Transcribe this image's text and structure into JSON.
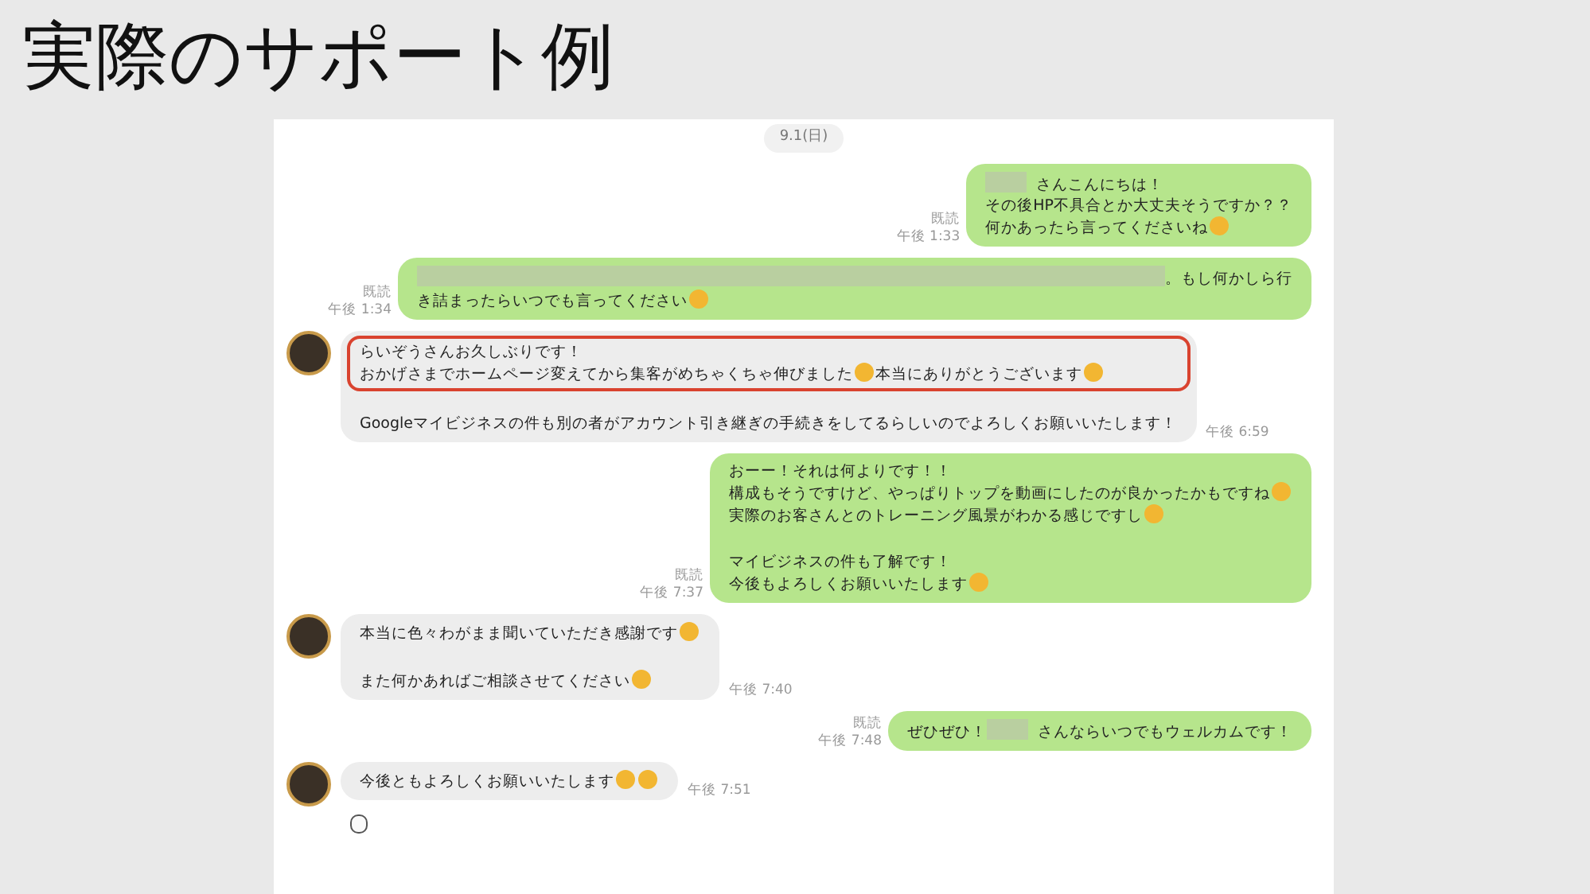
{
  "title": "実際のサポート例",
  "date": "9.1(日)",
  "messages": [
    {
      "kind": "outgoing",
      "read": "既読",
      "time": "午後 1:33",
      "blocks": [
        {
          "highlighted": false,
          "lines": [
            [
              {
                "kind": "redacted"
              },
              {
                "kind": "text",
                "text": "さんこんにちは！"
              }
            ],
            [
              {
                "kind": "text",
                "text": "その後HP不具合とか大丈夫そうですか？？"
              }
            ],
            [
              {
                "kind": "text",
                "text": "何かあったら言ってくださいね"
              },
              {
                "kind": "emoji"
              }
            ]
          ]
        }
      ]
    },
    {
      "kind": "outgoing",
      "read": "既読",
      "time": "午後 1:34",
      "blocks": [
        {
          "highlighted": false,
          "lines": [
            [
              {
                "kind": "redacted-long"
              },
              {
                "kind": "text",
                "text": "。もし何かしら行"
              }
            ],
            [
              {
                "kind": "text",
                "text": "き詰まったらいつでも言ってください"
              },
              {
                "kind": "emoji"
              }
            ]
          ]
        }
      ]
    },
    {
      "kind": "incoming",
      "time": "午後 6:59",
      "blocks": [
        {
          "highlighted": true,
          "lines": [
            [
              {
                "kind": "text",
                "text": "らいぞうさんお久しぶりです！"
              }
            ],
            [
              {
                "kind": "text",
                "text": "おかげさまでホームページ変えてから集客がめちゃくちゃ伸びました"
              },
              {
                "kind": "emoji"
              },
              {
                "kind": "text",
                "text": "本当にありがとうございます"
              },
              {
                "kind": "emoji"
              }
            ]
          ]
        },
        {
          "highlighted": false,
          "lines": [
            [
              {
                "kind": "text",
                "text": "Googleマイビジネスの件も別の者がアカウント引き継ぎの手続きをしてるらしいのでよろしくお願いいたします！"
              }
            ]
          ]
        }
      ]
    },
    {
      "kind": "outgoing",
      "read": "既読",
      "time": "午後 7:37",
      "blocks": [
        {
          "highlighted": false,
          "lines": [
            [
              {
                "kind": "text",
                "text": "おーー！それは何よりです！！"
              }
            ],
            [
              {
                "kind": "text",
                "text": "構成もそうですけど、やっぱりトップを動画にしたのが良かったかもですね"
              },
              {
                "kind": "emoji"
              }
            ],
            [
              {
                "kind": "text",
                "text": "実際のお客さんとのトレーニング風景がわかる感じですし"
              },
              {
                "kind": "emoji"
              }
            ]
          ]
        },
        {
          "highlighted": false,
          "lines": [
            [
              {
                "kind": "text",
                "text": "マイビジネスの件も了解です！"
              }
            ],
            [
              {
                "kind": "text",
                "text": "今後もよろしくお願いいたします"
              },
              {
                "kind": "emoji"
              }
            ]
          ]
        }
      ]
    },
    {
      "kind": "incoming",
      "time": "午後 7:40",
      "blocks": [
        {
          "highlighted": false,
          "lines": [
            [
              {
                "kind": "text",
                "text": "本当に色々わがまま聞いていただき感謝です"
              },
              {
                "kind": "emoji"
              }
            ]
          ]
        },
        {
          "highlighted": false,
          "lines": [
            [
              {
                "kind": "text",
                "text": "また何かあればご相談させてください"
              },
              {
                "kind": "emoji"
              }
            ]
          ]
        }
      ]
    },
    {
      "kind": "outgoing",
      "read": "既読",
      "time": "午後 7:48",
      "blocks": [
        {
          "highlighted": false,
          "lines": [
            [
              {
                "kind": "text",
                "text": "ぜひぜひ！"
              },
              {
                "kind": "redacted"
              },
              {
                "kind": "text",
                "text": "さんならいつでもウェルカムです！"
              }
            ]
          ]
        }
      ]
    },
    {
      "kind": "incoming",
      "time": "午後 7:51",
      "blocks": [
        {
          "highlighted": false,
          "lines": [
            [
              {
                "kind": "text",
                "text": "今後ともよろしくお願いいたします"
              },
              {
                "kind": "emoji"
              },
              {
                "kind": "emoji"
              }
            ]
          ]
        }
      ]
    },
    {
      "kind": "sticker"
    }
  ]
}
